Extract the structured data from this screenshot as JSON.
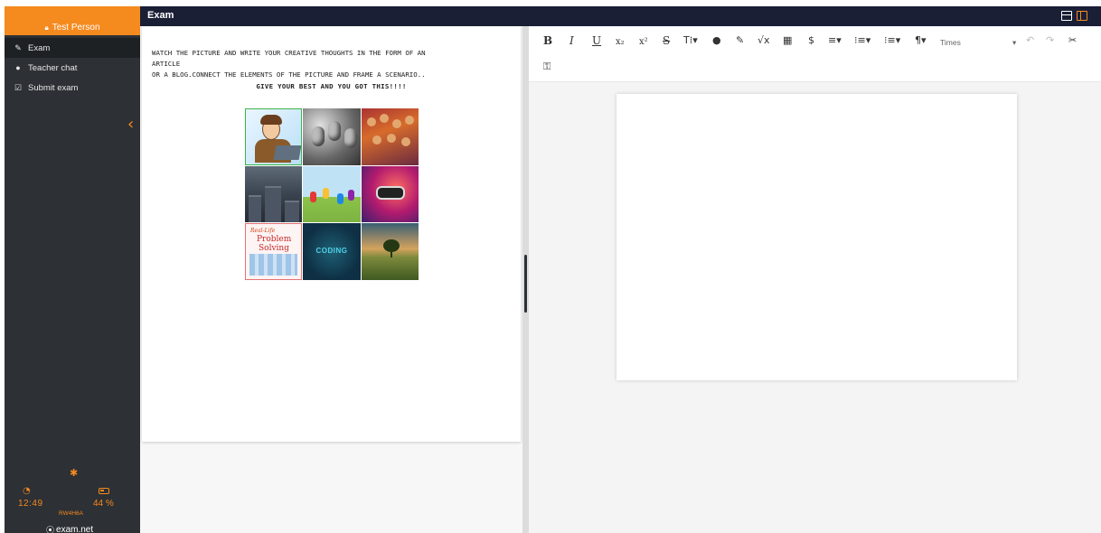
{
  "user": {
    "name": "Test Person"
  },
  "nav": [
    {
      "label": "Exam",
      "icon": "edit-icon"
    },
    {
      "label": "Teacher chat",
      "icon": "chat-icon"
    },
    {
      "label": "Submit exam",
      "icon": "checkbox-icon"
    }
  ],
  "status": {
    "time": "12:49",
    "battery": "44 %",
    "code": "RW4H6A",
    "brand": "exam.net"
  },
  "header": {
    "title": "Exam"
  },
  "question": {
    "line1": "WATCH THE PICTURE AND WRITE YOUR CREATIVE THOUGHTS IN THE FORM OF AN",
    "line2": "ARTICLE",
    "line3": "OR A BLOG.CONNECT THE ELEMENTS OF THE PICTURE AND FRAME A SCENARIO..",
    "line4": "GIVE YOUR BEST AND YOU GOT THIS!!!!"
  },
  "collage": {
    "tile7_small": "Real-Life",
    "tile7_line1": "Problem",
    "tile7_line2": "Solving",
    "tile8_text": "CODING"
  },
  "toolbar": {
    "bold": "B",
    "italic": "I",
    "underline": "U",
    "subscript": "x₂",
    "superscript": "x²",
    "strike": "S",
    "text_size": "T⁞▾",
    "color": "●",
    "brush": "✎",
    "math": "√x",
    "table": "▦",
    "dollar": "$",
    "align": "≡▾",
    "ordered": "⁝≡▾",
    "unordered": "⁝≡▾",
    "paragraph": "¶▾",
    "font": "Times",
    "font_arrow": "▾",
    "undo": "↶",
    "redo": "↷",
    "cut": "✂",
    "special": "⚿"
  },
  "colors": {
    "accent": "#f58a1f",
    "sidebar": "#2d3034",
    "header": "#1a1f36"
  }
}
